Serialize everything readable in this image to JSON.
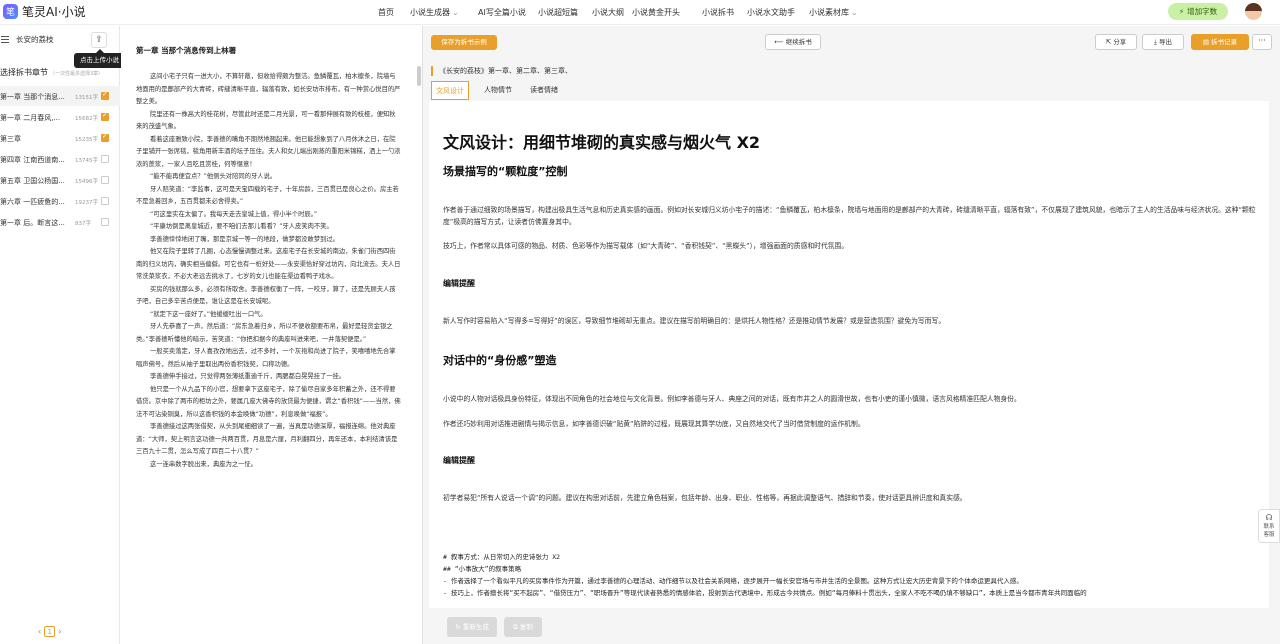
{
  "app": {
    "logo_text": "笔灵AI·小说",
    "logo_mark": "笔"
  },
  "nav": [
    {
      "label": "首页",
      "has_menu": false
    },
    {
      "label": "小说生成器",
      "has_menu": true
    },
    {
      "label": "AI写全篇小说",
      "has_menu": false
    },
    {
      "label": "小说超短篇",
      "has_menu": false
    },
    {
      "label": "小说大纲",
      "has_menu": false
    },
    {
      "label": "小说黄金开头",
      "has_menu": false
    },
    {
      "label": "小说拆书",
      "has_menu": false
    },
    {
      "label": "小说水文助手",
      "has_menu": false
    },
    {
      "label": "小说素材库",
      "has_menu": true
    }
  ],
  "buy_button": "增加字数",
  "sidebar": {
    "book_title": "长安的荔枝",
    "upload_tooltip": "点击上传小说",
    "section_title": "选择拆书章节",
    "section_hint": "（一次性最多选择3章）",
    "chapters": [
      {
        "name": "第一章 当那个消息...",
        "words": "13151字",
        "checked": true,
        "active": true
      },
      {
        "name": "第一章 二月春风,...",
        "words": "15682字",
        "checked": true,
        "active": false
      },
      {
        "name": "第三章",
        "words": "15235字",
        "checked": true,
        "active": false
      },
      {
        "name": "第四章 江南西道南...",
        "words": "13745字",
        "checked": false,
        "active": false
      },
      {
        "name": "第五章 卫国公杨国...",
        "words": "15496字",
        "checked": false,
        "active": false
      },
      {
        "name": "第六章 一匹疲惫的...",
        "words": "19237字",
        "checked": false,
        "active": false
      },
      {
        "name": "第一章 后。断言这...",
        "words": "837字",
        "checked": false,
        "active": false
      }
    ],
    "page": "1"
  },
  "reader": {
    "title": "第一章 当那个消息传到上林署",
    "paragraphs": [
      "这间小宅子只有一进大小，不算轩敞，但收拾得颇为整洁。鱼鳞覆瓦，柏木檩条，院墙与地面用的是鄜部产的大青砖，砖缝清晰平直，辐落有致，如长安坊市排布，有一种赏心悦目的严整之美。",
      "院里还有一株高大的桂花树，尽管此时还是二月光景，可一看那伸展有致的枝桠，便知秋来的茂盛气象。",
      "看着这座雅致小院，李善德的嘴角不期然地翘起来。他已能想象到了八月休沐之日，在院子里铺开一张席毯，毯角用新丰酒的坛子压住。夫人和女儿端出刚蒸的重阳米锦糕，洒上一勺浓浓的蔗浆，一家人且吃且赏桂，何等惬意！",
      "“能不能再便宜点？”他侧头对陪同的牙人说。",
      "牙人赔笑道：“李监事，这可是天宝四载的宅子，十年房龄，三百贯已是良心之价。房主若不是急着回乡，五百贯都未必舍得卖。”",
      "“可这里实在太偏了。我每天走去皇城上值，得小半个时辰。”",
      "“平康坊倒是离皇城近，要不咱们去那儿看看？”牙人皮笑肉不笑。",
      "李善德悻悻地闭了嘴，那是京城一等一的地段，做梦都没敢梦到过。",
      "他又在院子里转了几圈，心态慢慢调整过来。这座宅子在长安城的南边，朱雀门街西四街南的归义坊内，确实相当偏僻。可它也有一桩好处——永安渠恰好穿过坊内，向北流去。夫人日常洗菜浆衣，不必大老远去挑水了，七岁的女儿也能在渠边看鸭子戏水。",
      "买房的钱就那么多，必须有所取舍。李善德权衡了一阵，一咬牙，算了，还是先顾夫人孩子吧，自己多辛苦点便是，谁让这是在长安城呢。",
      "“就定下这一座好了。”他缓缓吐出一口气。",
      "牙人先恭喜了一声，然后道：“房东急着归乡，所以不便收额要布帛，最好是轻货金银之类。”李善德听懂他的暗示，苦笑道：“你把扣据今的典座叫进来吧，一并落契便是。”",
      "一般买卖落定，牙人喜孜孜地出去，过不多时，一个灰袍和尚进了院子，笑嘻嘻地先合掌唱声佛号，然后从袖子里取出两份香积钱契，口称功德。",
      "李善德伸手接过，只觉得两张薄纸重逾千斤，两腮都白晃晃挂了一挂。",
      "他只是一个从九品下的小官，想要拿下这座宅子，除了偷尽自家多年积蓄之外，还不得要借贷。京中除了两市的柜坊之外，要属几座大佛寺的放贷最为便捷，谓之“香积钱”——当然，佛法不可沾染铜臭，所以这香积钱的本金唤做“功德”，利息唤做“福报”。",
      "李善德接过这两张借契，从头到尾细细读了一遍，当真是功德深厚，福报连绵。他对典座道：“大师，契上明言这功德一共两百贯，月息是六厘，月利翻四分，再年还本，本利结清该是三百九十二贯，怎么写成了四百二十八贯？”",
      "这一连串数字脱出来，典座为之一怔。"
    ]
  },
  "toolbar": {
    "save_label": "保存为拆书示例",
    "continue_label": "继续拆书",
    "share_label": "分享",
    "export_label": "导出",
    "record_label": "拆书记录",
    "more_label": "···"
  },
  "breakdown": {
    "book_line": "《长安的荔枝》第一章、第二章、第三章、",
    "tabs": [
      "文风设计",
      "人物情节",
      "读者情绪"
    ],
    "active_tab": 0,
    "h1": "文风设计：用细节堆砌的真实感与烟火气 X2",
    "h2_a": "场景描写的“颗粒度”控制",
    "p_a1": "作者善于通过细致的场景描写，构建出极具生活气息和历史真实感的画面。例如对长安城归义坊小宅子的描述：“鱼鳞覆瓦，柏木檩条，院墙与地面用的是鄜部产的大青砖，砖缝清晰平直，辐落有致”，不仅展现了建筑风貌，也暗示了主人的生活品味与经济状况。这种“颗粒度”极高的描写方式，让读者仿佛置身其中。",
    "p_a2": "技巧上，作者常以具体可感的物品、材质、色彩等作为描写载体（如“大青砖”、“香积钱契”、“黑蝶头”），增强画面的质感和时代氛围。",
    "h3_a": "编辑提醒",
    "p_a3": "新人写作时容易陷入“写得多=写得好”的误区，导致细节堆砌却无重点。建议在描写前明确目的：是烘托人物性格？还是推动情节发展？或是营造氛围？避免为写而写。",
    "h2_b": "对话中的“身份感”塑造",
    "p_b1": "小说中的人物对话极具身份特征，体现出不同角色的社会地位与文化背景。例如李善德与牙人、典座之间的对话，既有市井之人的圆滑世故，也有小吏的谨小慎微，语言风格精准匹配人物身份。",
    "p_b2": "作者还巧妙利用对话推进剧情与揭示信息，如李善德识破“贴黄”陷阱的过程，既展现其算学功底，又自然地交代了当时借贷制度的运作机制。",
    "h3_b": "编辑提醒",
    "p_b3": "初学者易犯“所有人说话一个调”的问题。建议在构思对话前，先建立角色档案，包括年龄、出身、职业、性格等，再据此调整语气、措辞和节奏，使对话更具辨识度和真实感。",
    "md_lines": [
      "# 叙事方式：从日常切入的史诗张力 X2",
      "## “小事放大”的叙事策略",
      "- 作者选择了一个看似平凡的买房事件作为开篇，通过李善德的心理活动、动作细节以及社会关系网络，逐步展开一幅长安官场与市井生活的全景图。这种方式让宏大历史背景下的个体命运更具代入感。",
      "- 技巧上，作者擅长将“买不起房”、“借贷压力”、“职场晋升”等现代读者熟悉的情感体验，投射到古代语境中，形成古今共情点。例如“每月俸料十贯出头，全家人不吃不喝仍填不够缺口”，本质上是当今都市青年共同面临的"
    ],
    "regen_label": "重新生成",
    "copy_label": "复制"
  },
  "side_help": {
    "label_1": "联系",
    "label_2": "客服"
  }
}
